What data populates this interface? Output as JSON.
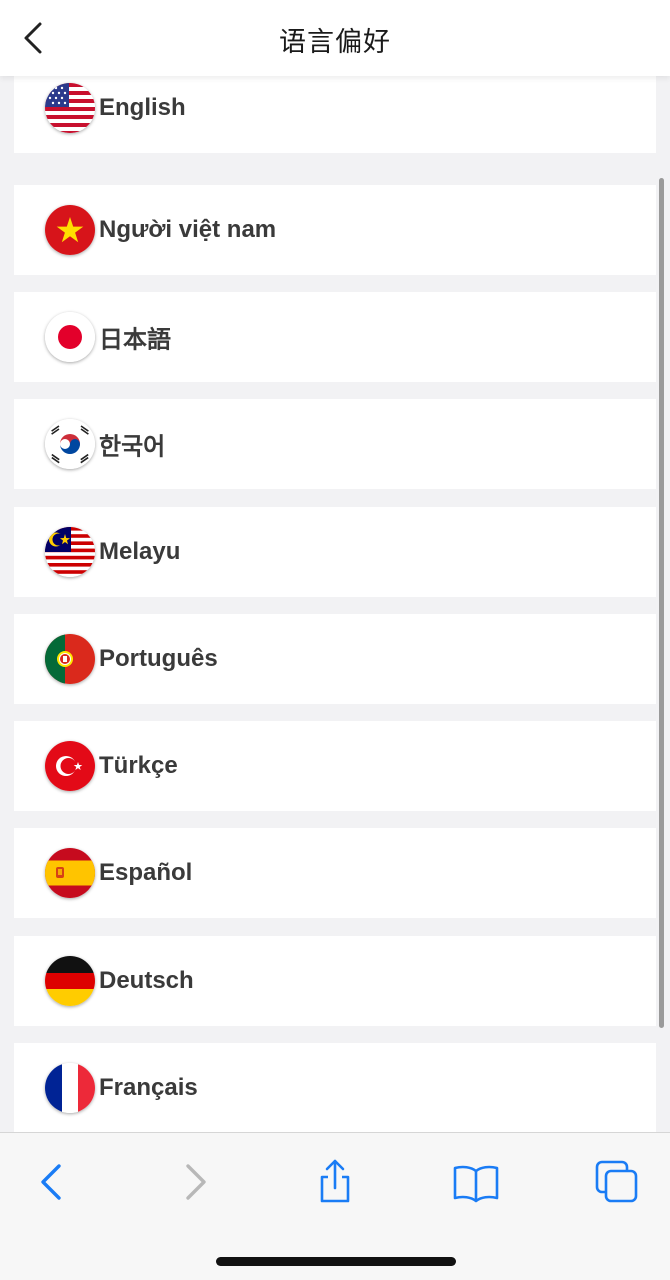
{
  "header": {
    "title": "语言偏好",
    "back_icon": "chevron-left-icon"
  },
  "languages": [
    {
      "id": "english",
      "label": "English",
      "flag": "us-flag-icon"
    },
    {
      "id": "vietnamese",
      "label": "Người việt nam",
      "flag": "vietnam-flag-icon"
    },
    {
      "id": "japanese",
      "label": "日本語",
      "flag": "japan-flag-icon"
    },
    {
      "id": "korean",
      "label": "한국어",
      "flag": "korea-flag-icon"
    },
    {
      "id": "malay",
      "label": "Melayu",
      "flag": "malaysia-flag-icon"
    },
    {
      "id": "portuguese",
      "label": "Português",
      "flag": "portugal-flag-icon"
    },
    {
      "id": "turkish",
      "label": "Türkçe",
      "flag": "turkey-flag-icon"
    },
    {
      "id": "spanish",
      "label": "Español",
      "flag": "spain-flag-icon"
    },
    {
      "id": "german",
      "label": "Deutsch",
      "flag": "germany-flag-icon"
    },
    {
      "id": "french",
      "label": "Français",
      "flag": "france-flag-icon"
    }
  ],
  "toolbar": {
    "back_icon": "browser-back-icon",
    "forward_icon": "browser-forward-icon",
    "share_icon": "share-icon",
    "bookmarks_icon": "bookmarks-icon",
    "tabs_icon": "tabs-icon"
  },
  "colors": {
    "accent": "#1a7cf5",
    "disabled": "#b8b8b8",
    "text": "#3a3a3a",
    "background": "#f2f2f4"
  }
}
